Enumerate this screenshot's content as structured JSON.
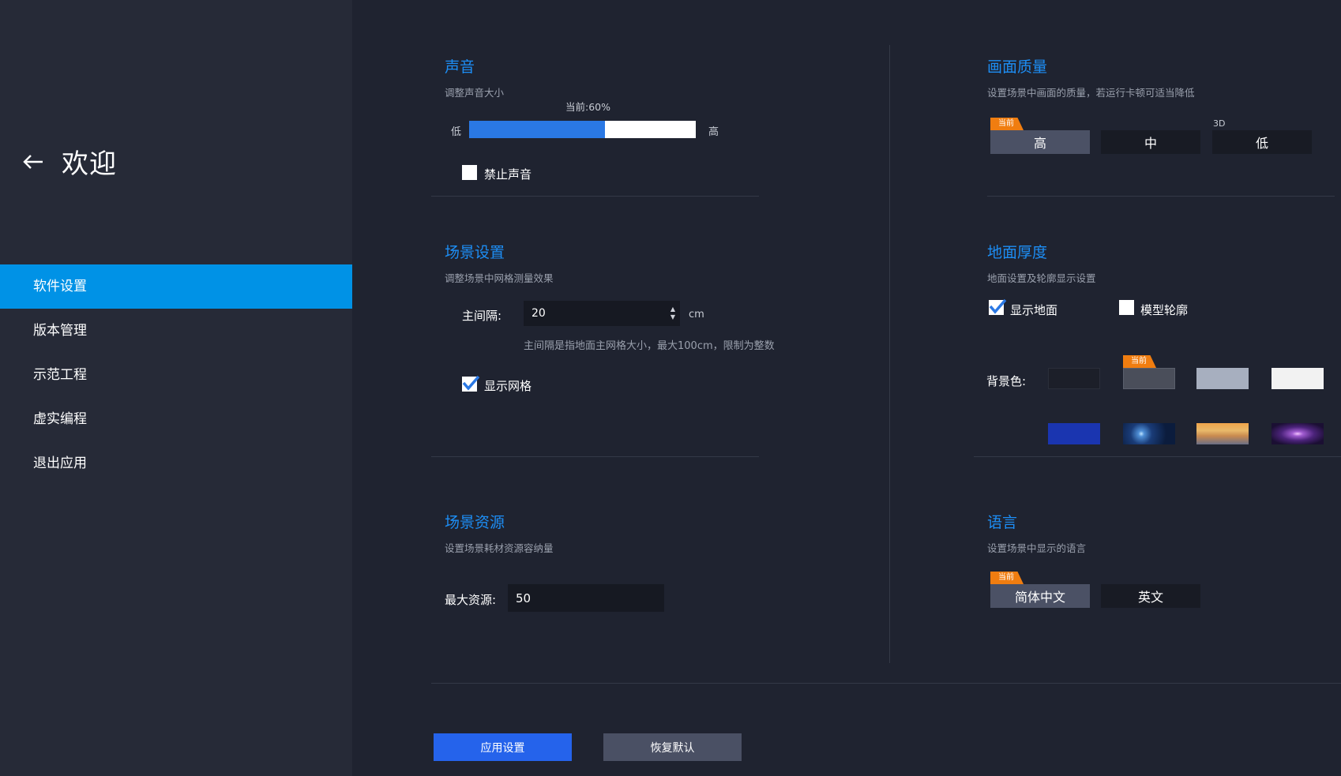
{
  "sidebar": {
    "title": "欢迎",
    "items": [
      {
        "label": "软件设置",
        "active": true
      },
      {
        "label": "版本管理",
        "active": false
      },
      {
        "label": "示范工程",
        "active": false
      },
      {
        "label": "虚实编程",
        "active": false
      },
      {
        "label": "退出应用",
        "active": false
      }
    ]
  },
  "sound": {
    "title": "声音",
    "subtitle": "调整声音大小",
    "current_label": "当前:60%",
    "volume_percent": 60,
    "low_label": "低",
    "high_label": "高",
    "mute_label": "禁止声音",
    "mute_checked": false
  },
  "scene": {
    "title": "场景设置",
    "subtitle": "调整场景中网格测量效果",
    "interval_label": "主间隔:",
    "interval_value": "20",
    "interval_unit": "cm",
    "interval_hint": "主间隔是指地面主网格大小，最大100cm，限制为整数",
    "grid_label": "显示网格",
    "grid_checked": true
  },
  "resource": {
    "title": "场景资源",
    "subtitle": "设置场景耗材资源容纳量",
    "max_label": "最大资源:",
    "max_value": "50"
  },
  "quality": {
    "title": "画面质量",
    "subtitle": "设置场景中画面的质量，若运行卡顿可适当降低",
    "current_tag": "当前",
    "tag_3d": "3D",
    "options": [
      "高",
      "中",
      "低"
    ],
    "selected": 0
  },
  "ground": {
    "title": "地面厚度",
    "subtitle": "地面设置及轮廓显示设置",
    "show_ground_label": "显示地面",
    "show_ground_checked": true,
    "outline_label": "模型轮廓",
    "outline_checked": false,
    "bg_label": "背景色:",
    "current_tag": "当前",
    "selected_swatch": 1,
    "swatch_colors": [
      "#1c1f29",
      "#4a4e5a",
      "#a7afbf",
      "#f2f2f2",
      "#1a35b0"
    ],
    "image_swatches": [
      "starfield-blue",
      "sunset-clouds",
      "purple-galaxy"
    ]
  },
  "language": {
    "title": "语言",
    "subtitle": "设置场景中显示的语言",
    "current_tag": "当前",
    "options": [
      "简体中文",
      "英文"
    ],
    "selected": 0
  },
  "footer": {
    "apply_label": "应用设置",
    "reset_label": "恢复默认"
  },
  "colors": {
    "accent": "#1d8ef5",
    "nav_active": "#0092e6",
    "apply_button": "#2563eb",
    "reset_button": "#4a5064",
    "current_tag": "#f07d10"
  }
}
